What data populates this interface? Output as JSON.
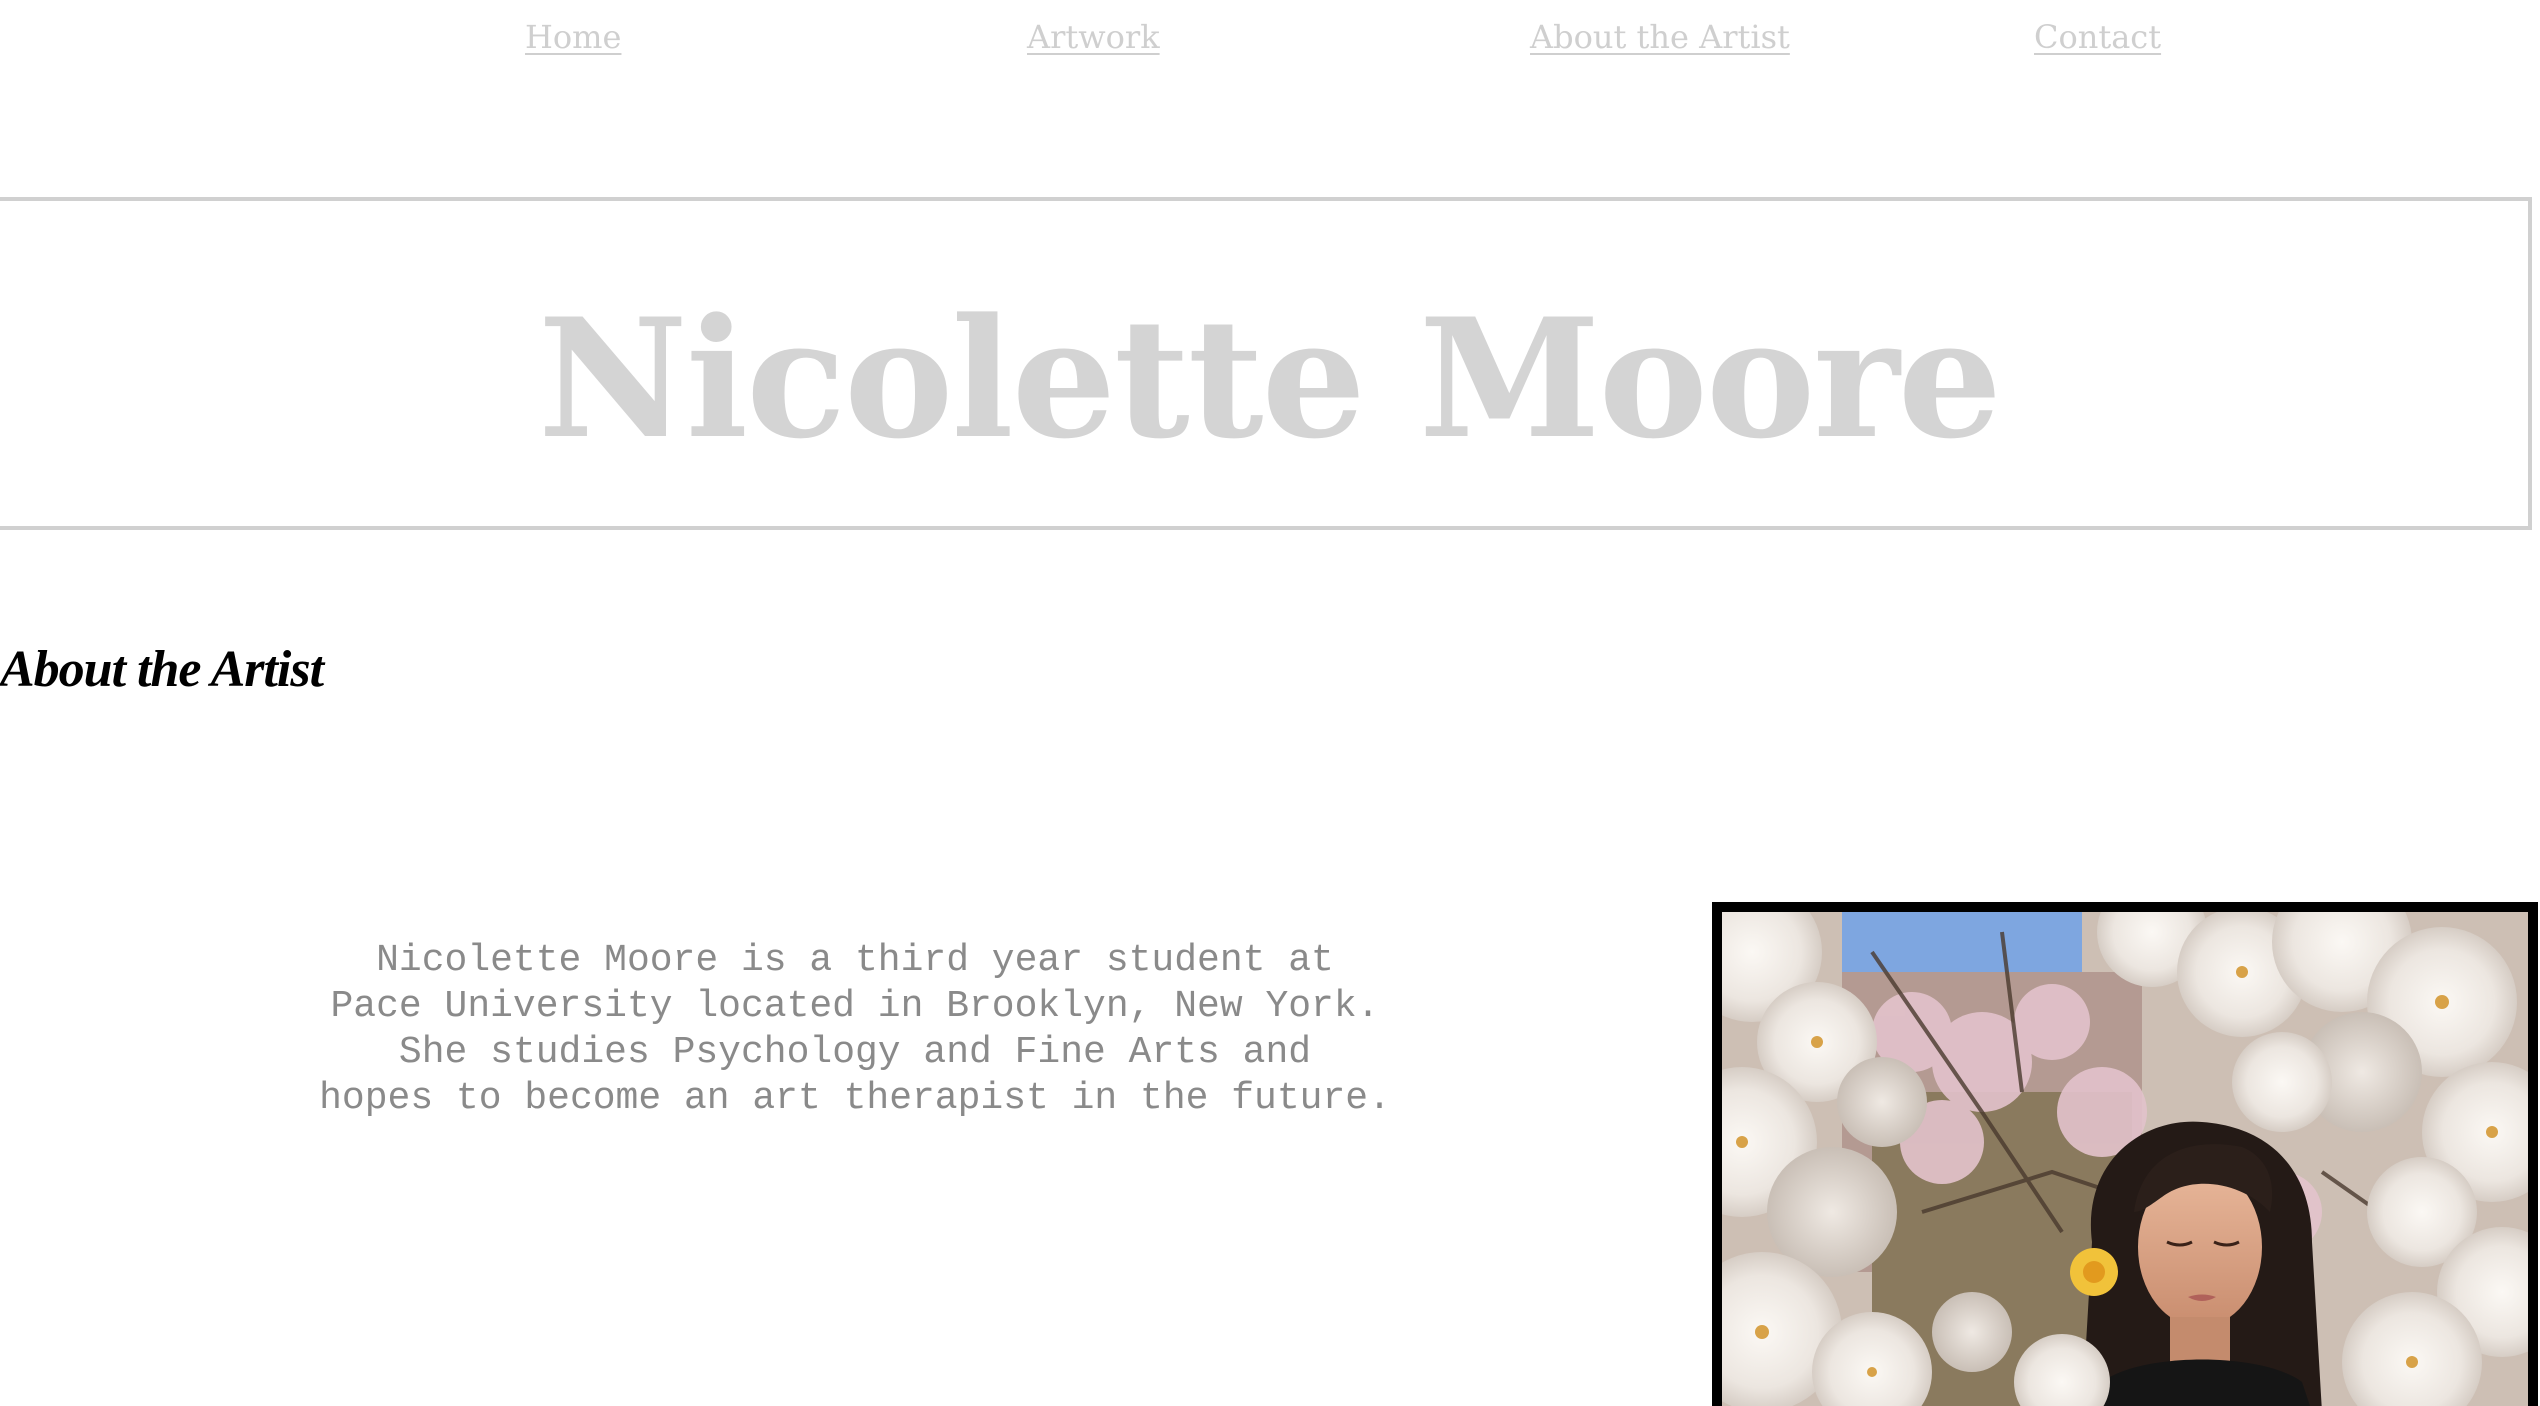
{
  "nav": {
    "items": [
      {
        "label": "Home"
      },
      {
        "label": "Artwork"
      },
      {
        "label": "About the Artist"
      },
      {
        "label": "Contact"
      }
    ]
  },
  "header": {
    "title": "Nicolette Moore"
  },
  "about": {
    "heading": "About the Artist",
    "bio_lines": [
      "Nicolette Moore is a third year student at",
      "Pace University located in Brooklyn, New York.",
      "She studies Psychology and Fine Arts and",
      "hopes to become an art therapist in the future."
    ]
  },
  "photo": {
    "subject": "artist-portrait-blossoms"
  },
  "colors": {
    "nav_link": "#cfcfcf",
    "title": "#d4d4d4",
    "banner_border": "#d0d0d0",
    "heading": "#000000",
    "body_text": "#8a8a8a",
    "photo_border": "#000000"
  }
}
